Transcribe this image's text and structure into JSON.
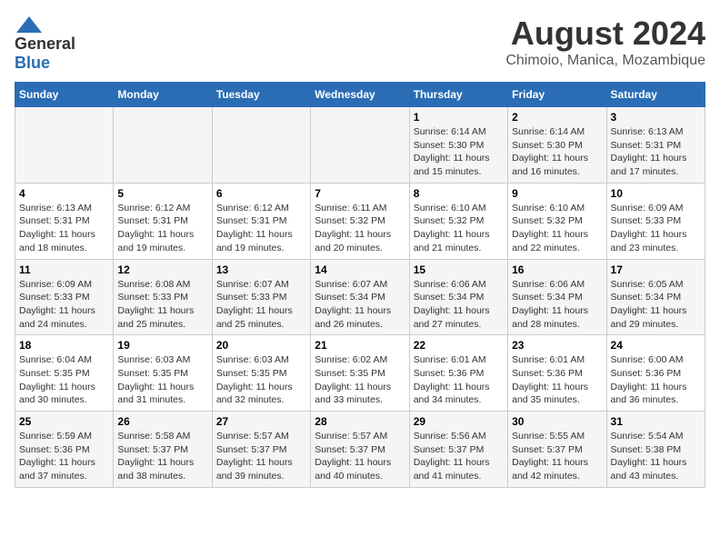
{
  "header": {
    "logo_general": "General",
    "logo_blue": "Blue",
    "title": "August 2024",
    "subtitle": "Chimoio, Manica, Mozambique"
  },
  "calendar": {
    "days_of_week": [
      "Sunday",
      "Monday",
      "Tuesday",
      "Wednesday",
      "Thursday",
      "Friday",
      "Saturday"
    ],
    "weeks": [
      [
        {
          "day": "",
          "info": ""
        },
        {
          "day": "",
          "info": ""
        },
        {
          "day": "",
          "info": ""
        },
        {
          "day": "",
          "info": ""
        },
        {
          "day": "1",
          "info": "Sunrise: 6:14 AM\nSunset: 5:30 PM\nDaylight: 11 hours\nand 15 minutes."
        },
        {
          "day": "2",
          "info": "Sunrise: 6:14 AM\nSunset: 5:30 PM\nDaylight: 11 hours\nand 16 minutes."
        },
        {
          "day": "3",
          "info": "Sunrise: 6:13 AM\nSunset: 5:31 PM\nDaylight: 11 hours\nand 17 minutes."
        }
      ],
      [
        {
          "day": "4",
          "info": "Sunrise: 6:13 AM\nSunset: 5:31 PM\nDaylight: 11 hours\nand 18 minutes."
        },
        {
          "day": "5",
          "info": "Sunrise: 6:12 AM\nSunset: 5:31 PM\nDaylight: 11 hours\nand 19 minutes."
        },
        {
          "day": "6",
          "info": "Sunrise: 6:12 AM\nSunset: 5:31 PM\nDaylight: 11 hours\nand 19 minutes."
        },
        {
          "day": "7",
          "info": "Sunrise: 6:11 AM\nSunset: 5:32 PM\nDaylight: 11 hours\nand 20 minutes."
        },
        {
          "day": "8",
          "info": "Sunrise: 6:10 AM\nSunset: 5:32 PM\nDaylight: 11 hours\nand 21 minutes."
        },
        {
          "day": "9",
          "info": "Sunrise: 6:10 AM\nSunset: 5:32 PM\nDaylight: 11 hours\nand 22 minutes."
        },
        {
          "day": "10",
          "info": "Sunrise: 6:09 AM\nSunset: 5:33 PM\nDaylight: 11 hours\nand 23 minutes."
        }
      ],
      [
        {
          "day": "11",
          "info": "Sunrise: 6:09 AM\nSunset: 5:33 PM\nDaylight: 11 hours\nand 24 minutes."
        },
        {
          "day": "12",
          "info": "Sunrise: 6:08 AM\nSunset: 5:33 PM\nDaylight: 11 hours\nand 25 minutes."
        },
        {
          "day": "13",
          "info": "Sunrise: 6:07 AM\nSunset: 5:33 PM\nDaylight: 11 hours\nand 25 minutes."
        },
        {
          "day": "14",
          "info": "Sunrise: 6:07 AM\nSunset: 5:34 PM\nDaylight: 11 hours\nand 26 minutes."
        },
        {
          "day": "15",
          "info": "Sunrise: 6:06 AM\nSunset: 5:34 PM\nDaylight: 11 hours\nand 27 minutes."
        },
        {
          "day": "16",
          "info": "Sunrise: 6:06 AM\nSunset: 5:34 PM\nDaylight: 11 hours\nand 28 minutes."
        },
        {
          "day": "17",
          "info": "Sunrise: 6:05 AM\nSunset: 5:34 PM\nDaylight: 11 hours\nand 29 minutes."
        }
      ],
      [
        {
          "day": "18",
          "info": "Sunrise: 6:04 AM\nSunset: 5:35 PM\nDaylight: 11 hours\nand 30 minutes."
        },
        {
          "day": "19",
          "info": "Sunrise: 6:03 AM\nSunset: 5:35 PM\nDaylight: 11 hours\nand 31 minutes."
        },
        {
          "day": "20",
          "info": "Sunrise: 6:03 AM\nSunset: 5:35 PM\nDaylight: 11 hours\nand 32 minutes."
        },
        {
          "day": "21",
          "info": "Sunrise: 6:02 AM\nSunset: 5:35 PM\nDaylight: 11 hours\nand 33 minutes."
        },
        {
          "day": "22",
          "info": "Sunrise: 6:01 AM\nSunset: 5:36 PM\nDaylight: 11 hours\nand 34 minutes."
        },
        {
          "day": "23",
          "info": "Sunrise: 6:01 AM\nSunset: 5:36 PM\nDaylight: 11 hours\nand 35 minutes."
        },
        {
          "day": "24",
          "info": "Sunrise: 6:00 AM\nSunset: 5:36 PM\nDaylight: 11 hours\nand 36 minutes."
        }
      ],
      [
        {
          "day": "25",
          "info": "Sunrise: 5:59 AM\nSunset: 5:36 PM\nDaylight: 11 hours\nand 37 minutes."
        },
        {
          "day": "26",
          "info": "Sunrise: 5:58 AM\nSunset: 5:37 PM\nDaylight: 11 hours\nand 38 minutes."
        },
        {
          "day": "27",
          "info": "Sunrise: 5:57 AM\nSunset: 5:37 PM\nDaylight: 11 hours\nand 39 minutes."
        },
        {
          "day": "28",
          "info": "Sunrise: 5:57 AM\nSunset: 5:37 PM\nDaylight: 11 hours\nand 40 minutes."
        },
        {
          "day": "29",
          "info": "Sunrise: 5:56 AM\nSunset: 5:37 PM\nDaylight: 11 hours\nand 41 minutes."
        },
        {
          "day": "30",
          "info": "Sunrise: 5:55 AM\nSunset: 5:37 PM\nDaylight: 11 hours\nand 42 minutes."
        },
        {
          "day": "31",
          "info": "Sunrise: 5:54 AM\nSunset: 5:38 PM\nDaylight: 11 hours\nand 43 minutes."
        }
      ]
    ]
  }
}
